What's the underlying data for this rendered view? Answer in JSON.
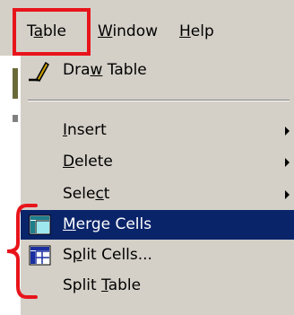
{
  "menubar": {
    "items": [
      {
        "pre": "T",
        "mn": "a",
        "post": "ble"
      },
      {
        "pre": "",
        "mn": "W",
        "post": "indow"
      },
      {
        "pre": "",
        "mn": "H",
        "post": "elp"
      }
    ]
  },
  "menu": {
    "draw_table": {
      "pre": "Dra",
      "mn": "w",
      "post": " Table",
      "icon": "pencil-icon"
    },
    "insert": {
      "pre": "",
      "mn": "I",
      "post": "nsert"
    },
    "delete": {
      "pre": "",
      "mn": "D",
      "post": "elete"
    },
    "select": {
      "pre": "Sele",
      "mn": "c",
      "post": "t"
    },
    "merge_cells": {
      "pre": "",
      "mn": "M",
      "post": "erge Cells",
      "icon": "merge-cells-icon"
    },
    "split_cells": {
      "pre": "S",
      "mn": "p",
      "post": "lit Cells...",
      "icon": "split-cells-icon"
    },
    "split_table": {
      "pre": "Split ",
      "mn": "T",
      "post": "able"
    }
  },
  "colors": {
    "menu_bg": "#d4d0c8",
    "selection": "#0a246a",
    "annotation": "#e8141b"
  }
}
